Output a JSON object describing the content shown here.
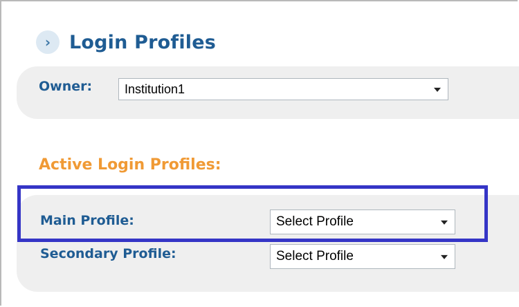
{
  "header": {
    "title": "Login Profiles",
    "chevron_icon": "chevron-right-icon"
  },
  "owner": {
    "label": "Owner:",
    "value": "Institution1"
  },
  "active": {
    "title": "Active Login Profiles:",
    "main": {
      "label": "Main Profile:",
      "value": "Select Profile"
    },
    "secondary": {
      "label": "Secondary Profile:",
      "value": "Select Profile"
    }
  },
  "colors": {
    "title_blue": "#1f5c93",
    "section_orange": "#f09a35",
    "panel_gray": "#efefef",
    "highlight_blue": "#3535c6"
  }
}
